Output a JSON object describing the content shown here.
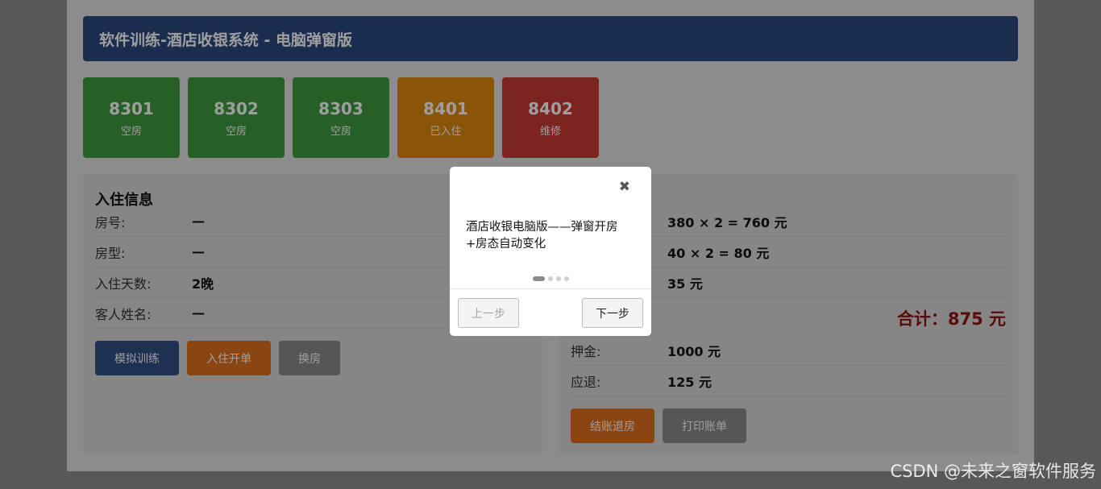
{
  "header": {
    "title": "软件训练-酒店收银系统 - 电脑弹窗版"
  },
  "rooms": [
    {
      "number": "8301",
      "status": "空房",
      "color": "#3f9b3f"
    },
    {
      "number": "8302",
      "status": "空房",
      "color": "#3f9b3f"
    },
    {
      "number": "8303",
      "status": "空房",
      "color": "#3f9b3f"
    },
    {
      "number": "8401",
      "status": "已入住",
      "color": "#e08a10"
    },
    {
      "number": "8402",
      "status": "维修",
      "color": "#c83a32"
    }
  ],
  "checkin": {
    "title": "入住信息",
    "rows": [
      {
        "label": "房号:",
        "value": "—"
      },
      {
        "label": "房型:",
        "value": "—"
      },
      {
        "label": "入住天数:",
        "value": "2晚"
      },
      {
        "label": "客人姓名:",
        "value": "—"
      }
    ],
    "buttons": {
      "simulate": "模拟训练",
      "open": "入住开单",
      "change": "换房"
    }
  },
  "bill": {
    "rows": [
      {
        "value": "380 × 2 = 760 元"
      },
      {
        "value": "40 × 2 = 80 元"
      },
      {
        "value": "35 元"
      }
    ],
    "total": "合计：875 元",
    "deposit_label": "押金:",
    "deposit_value": "1000 元",
    "refund_label": "应退:",
    "refund_value": "125 元",
    "buttons": {
      "checkout": "结账退房",
      "print": "打印账单"
    }
  },
  "modal": {
    "close": "✖",
    "text": "酒店收银电脑版——弹窗开房+房态自动变化",
    "steps_total": 4,
    "step_active": 1,
    "prev_label": "上一步",
    "next_label": "下一步"
  },
  "colors": {
    "header": "#2a4a7f",
    "btn_blue": "#2f4f86",
    "btn_orange": "#e0701a",
    "btn_gray": "#8c8c8c",
    "total": "#8e1212"
  },
  "watermark": "CSDN @未来之窗软件服务"
}
